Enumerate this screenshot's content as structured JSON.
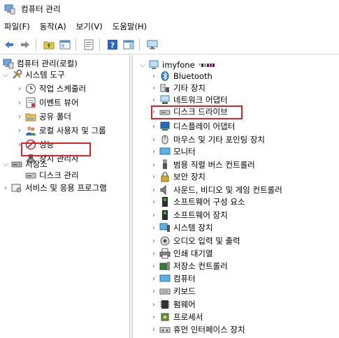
{
  "window": {
    "title": "컴퓨터 관리"
  },
  "menu": [
    "파일(F)",
    "동작(A)",
    "보기(V)",
    "도움말(H)"
  ],
  "toolbar": {
    "buttons": [
      "back-icon",
      "forward-icon",
      "folder-up-icon",
      "show-hide-tree-icon",
      "properties-icon",
      "help-icon",
      "action-pane-icon",
      "monitor-icon"
    ]
  },
  "left_tree": {
    "root": "컴퓨터 관리(로컬)",
    "system_tools": "시스템 도구",
    "task_scheduler": "작업 스케줄러",
    "event_viewer": "이벤트 뷰어",
    "shared_folders": "공유 폴더",
    "local_users": "로컬 사용자 및 그룹",
    "performance": "성능",
    "device_manager": "장치 관리자",
    "storage": "저장소",
    "disk_management": "디스크 관리",
    "services": "서비스 및 응용 프로그램"
  },
  "right_tree": {
    "computer_name": "imyfone",
    "items": [
      "Bluetooth",
      "기타 장치",
      "네트워크 어댑터",
      "디스크 드라이브",
      "디스플레이 어댑터",
      "마우스 및 기타 포인팅 장치",
      "모니터",
      "범용 직렬 버스 컨트롤러",
      "보안 장치",
      "사운드, 비디오 및 게임 컨트롤러",
      "소프트웨어 구성 요소",
      "소프트웨어 장치",
      "시스템 장치",
      "오디오 입력 및 출력",
      "인쇄 대기열",
      "저장소 컨트롤러",
      "컴퓨터",
      "키보드",
      "펌웨어",
      "프로세서",
      "휴먼 인터페이스 장치"
    ]
  },
  "colors": {
    "highlight": "#e0212a",
    "blue_icon": "#1f6fbf"
  }
}
